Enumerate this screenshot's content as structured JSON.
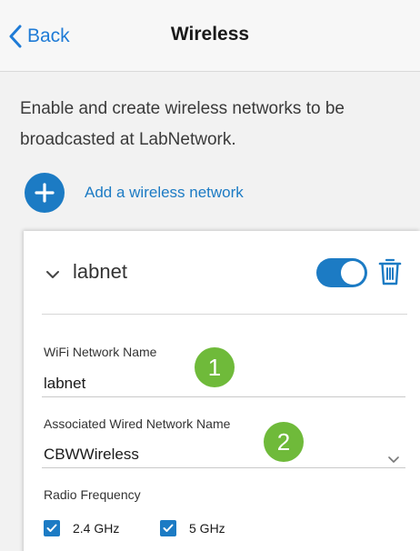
{
  "header": {
    "back_label": "Back",
    "title": "Wireless"
  },
  "intro": {
    "text": "Enable and create wireless networks to be broadcasted at LabNetwork."
  },
  "add_network": {
    "label": "Add a wireless network"
  },
  "network": {
    "name": "labnet",
    "enabled": true,
    "wifi_name_label": "WiFi Network Name",
    "wifi_name_value": "labnet",
    "wired_label": "Associated Wired Network Name",
    "wired_value": "CBWWireless",
    "radio_label": "Radio Frequency",
    "radio_options": [
      {
        "label": "2.4 GHz",
        "checked": true
      },
      {
        "label": "5 GHz",
        "checked": true
      }
    ]
  },
  "annotations": {
    "badge_1": "1",
    "badge_2": "2"
  },
  "colors": {
    "accent": "#1c7bc4",
    "link": "#1f7bd6",
    "badge": "#6fba3a"
  }
}
